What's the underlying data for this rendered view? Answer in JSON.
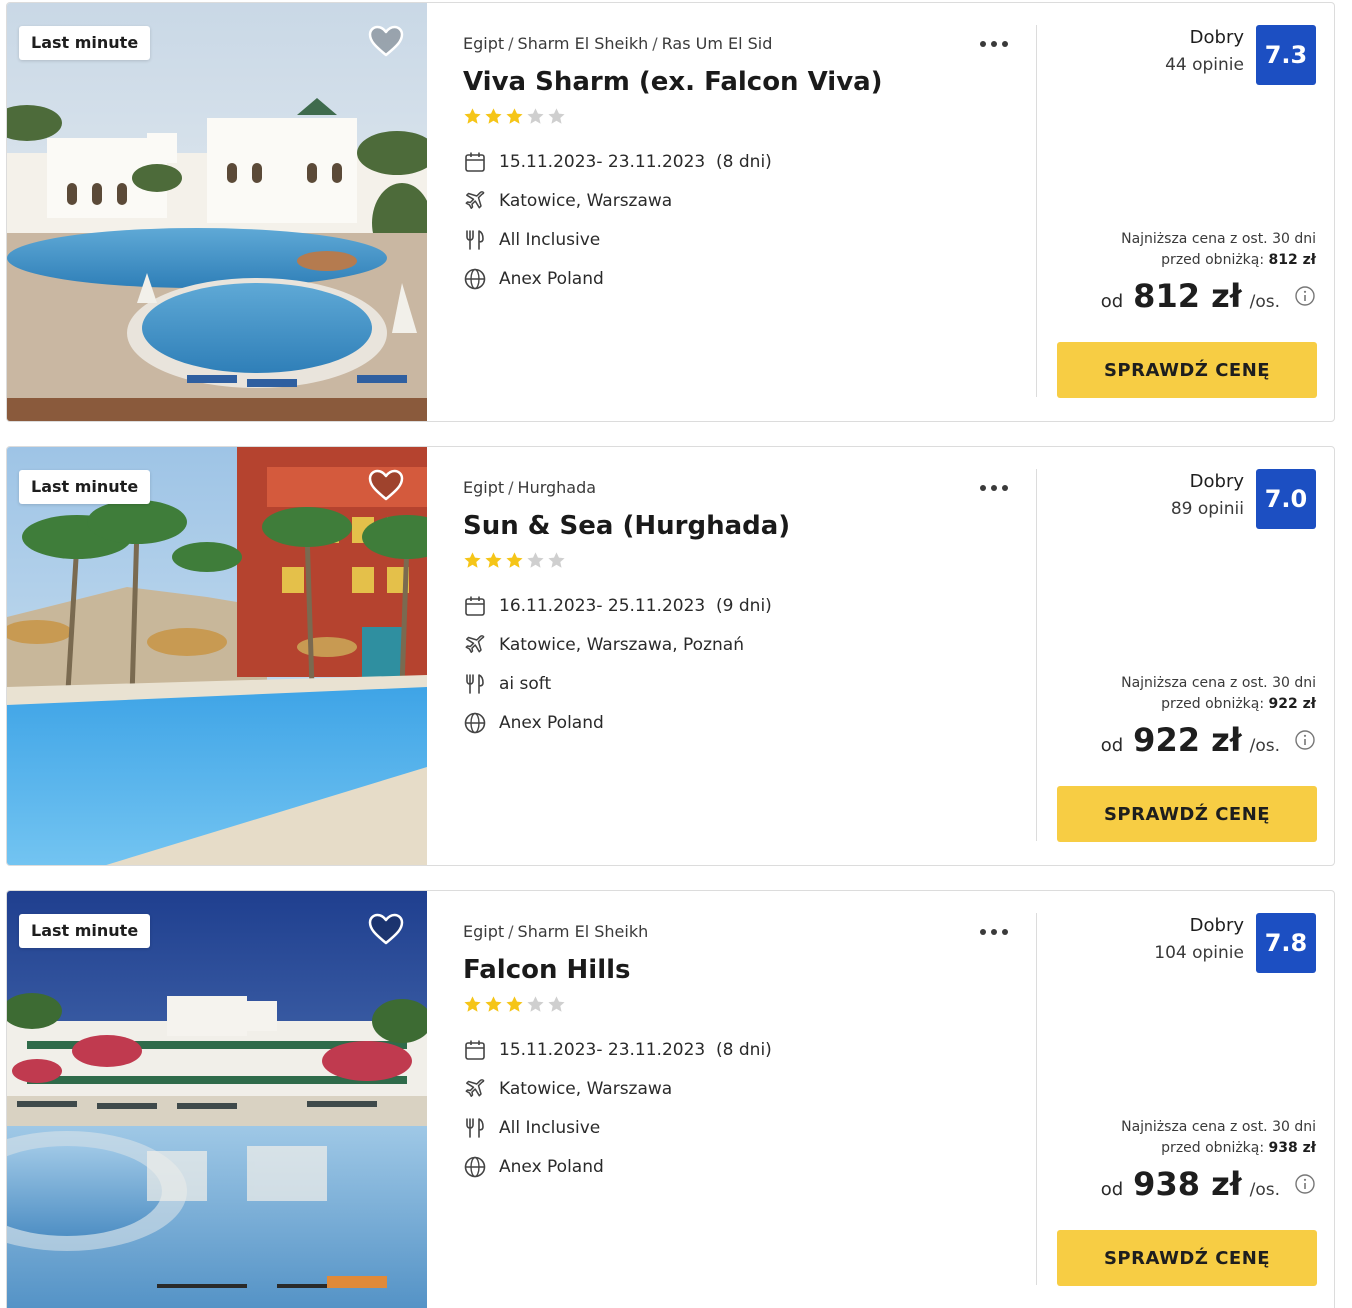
{
  "colors": {
    "cta": "#f7cd44",
    "score_badge": "#1c4fc2",
    "star_filled": "#f5c518",
    "star_empty": "#cfcfcf"
  },
  "offers": [
    {
      "badge": "Last minute",
      "breadcrumb": [
        "Egipt",
        "Sharm El Sheikh",
        "Ras Um El Sid"
      ],
      "title": "Viva Sharm (ex. Falcon Viva)",
      "stars": 3,
      "stars_max": 5,
      "dates": "15.11.2023- 23.11.2023",
      "duration": "(8 dni)",
      "departures": "Katowice, Warszawa",
      "board": "All Inclusive",
      "operator": "Anex Poland",
      "rating_word": "Dobry",
      "rating_count": "44 opinie",
      "score": "7.3",
      "lowest_line1": "Najniższa cena z ost. 30 dni",
      "lowest_line2": "przed obniżką:",
      "lowest_value": "812 zł",
      "price_prefix": "od",
      "price": "812 zł",
      "price_suffix": "/os.",
      "cta": "SPRAWDŹ CENĘ",
      "favorited": false
    },
    {
      "badge": "Last minute",
      "breadcrumb": [
        "Egipt",
        "Hurghada"
      ],
      "title": "Sun & Sea (Hurghada)",
      "stars": 3,
      "stars_max": 5,
      "dates": "16.11.2023- 25.11.2023",
      "duration": "(9 dni)",
      "departures": "Katowice, Warszawa, Poznań",
      "board": "ai soft",
      "operator": "Anex Poland",
      "rating_word": "Dobry",
      "rating_count": "89 opinii",
      "score": "7.0",
      "lowest_line1": "Najniższa cena z ost. 30 dni",
      "lowest_line2": "przed obniżką:",
      "lowest_value": "922 zł",
      "price_prefix": "od",
      "price": "922 zł",
      "price_suffix": "/os.",
      "cta": "SPRAWDŹ CENĘ",
      "favorited": false
    },
    {
      "badge": "Last minute",
      "breadcrumb": [
        "Egipt",
        "Sharm El Sheikh"
      ],
      "title": "Falcon Hills",
      "stars": 3,
      "stars_max": 5,
      "dates": "15.11.2023- 23.11.2023",
      "duration": "(8 dni)",
      "departures": "Katowice, Warszawa",
      "board": "All Inclusive",
      "operator": "Anex Poland",
      "rating_word": "Dobry",
      "rating_count": "104 opinie",
      "score": "7.8",
      "lowest_line1": "Najniższa cena z ost. 30 dni",
      "lowest_line2": "przed obniżką:",
      "lowest_value": "938 zł",
      "price_prefix": "od",
      "price": "938 zł",
      "price_suffix": "/os.",
      "cta": "SPRAWDŹ CENĘ",
      "favorited": false
    }
  ]
}
